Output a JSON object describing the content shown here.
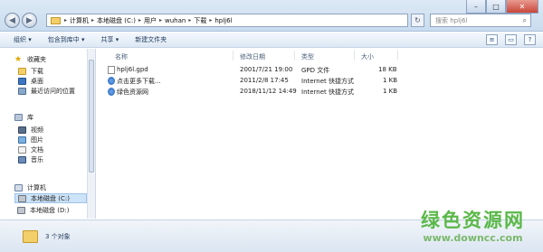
{
  "address": {
    "crumbs": [
      "计算机",
      "本地磁盘 (C:)",
      "用户",
      "wuhan",
      "下载",
      "hplj6l"
    ]
  },
  "search": {
    "placeholder": "搜索 hplj6l"
  },
  "toolbar": {
    "organize": "组织 ▾",
    "include_in_library": "包含到库中 ▾",
    "share": "共享 ▾",
    "new_folder": "新建文件夹"
  },
  "nav": {
    "favorites": "收藏夹",
    "downloads": "下载",
    "desktop": "桌面",
    "recent": "最近访问的位置",
    "libraries": "库",
    "videos": "视频",
    "pictures": "图片",
    "documents": "文档",
    "music": "音乐",
    "computer": "计算机",
    "drive_c": "本地磁盘 (C:)",
    "drive_d": "本地磁盘 (D:)"
  },
  "columns": {
    "name": "名称",
    "modified": "修改日期",
    "type": "类型",
    "size": "大小"
  },
  "files": [
    {
      "name": "hplj6l.gpd",
      "modified": "2001/7/21 19:00",
      "type": "GPD 文件",
      "size": "18 KB",
      "icon": "gpd-file-icon"
    },
    {
      "name": "点击更多下载...",
      "modified": "2011/2/8 17:45",
      "type": "Internet 快捷方式",
      "size": "1 KB",
      "icon": "internet-shortcut-icon"
    },
    {
      "name": "绿色资源网",
      "modified": "2018/11/12 14:49",
      "type": "Internet 快捷方式",
      "size": "1 KB",
      "icon": "internet-shortcut-icon"
    }
  ],
  "status": {
    "count": "3 个对象"
  },
  "watermark": {
    "cn": "绿色资源网",
    "url": "www.downcc.com"
  },
  "colors": {
    "accent": "#5ab848",
    "folder": "#f3cf6a"
  }
}
